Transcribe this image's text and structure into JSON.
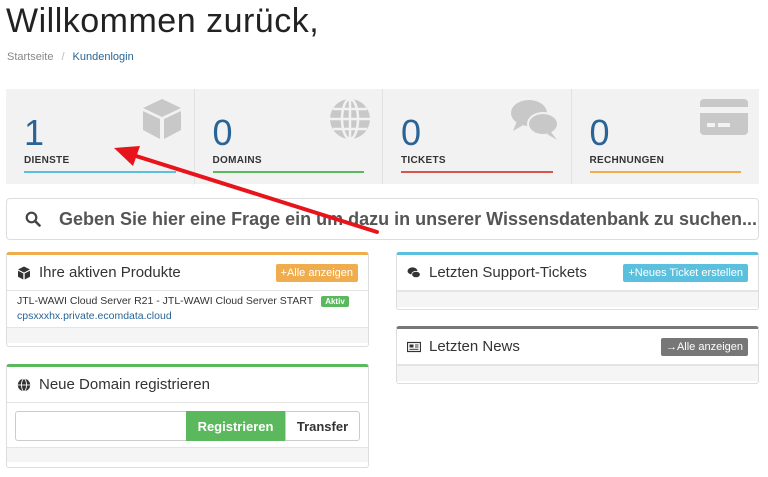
{
  "page": {
    "title": "Willkommen zurück,",
    "breadcrumb": [
      "Startseite",
      "Kundenlogin"
    ]
  },
  "stats": [
    {
      "count": "1",
      "label": "DIENSTE",
      "icon": "cube-icon",
      "color": "#5bc0de"
    },
    {
      "count": "0",
      "label": "DOMAINS",
      "icon": "globe-icon",
      "color": "#5cb85c"
    },
    {
      "count": "0",
      "label": "TICKETS",
      "icon": "comments-icon",
      "color": "#d9534f"
    },
    {
      "count": "0",
      "label": "RECHNUNGEN",
      "icon": "credit-card-icon",
      "color": "#f0ad4e"
    }
  ],
  "search": {
    "placeholder": "Geben Sie hier eine Frage ein um dazu in unserer Wissensdatenbank zu suchen..."
  },
  "products": {
    "title": "Ihre aktiven Produkte",
    "button": "Alle anzeigen",
    "items": [
      {
        "name": "JTL-WAWI Cloud Server R21 - JTL-WAWI Cloud Server START",
        "status": "Aktiv",
        "host": "cpsxxxhx.private.ecomdata.cloud"
      }
    ]
  },
  "tickets": {
    "title": "Letzten Support-Tickets",
    "button": "Neues Ticket erstellen"
  },
  "news": {
    "title": "Letzten News",
    "button": "Alle anzeigen"
  },
  "domain": {
    "title": "Neue Domain registrieren",
    "register": "Registrieren",
    "transfer": "Transfer",
    "input_value": ""
  },
  "colors": {
    "accent": "#2a6496",
    "orange": "#f0ad4e",
    "blue": "#5bc0de",
    "green": "#5cb85c",
    "red": "#d9534f",
    "gray": "#777777",
    "annotation": "#e8141b"
  }
}
